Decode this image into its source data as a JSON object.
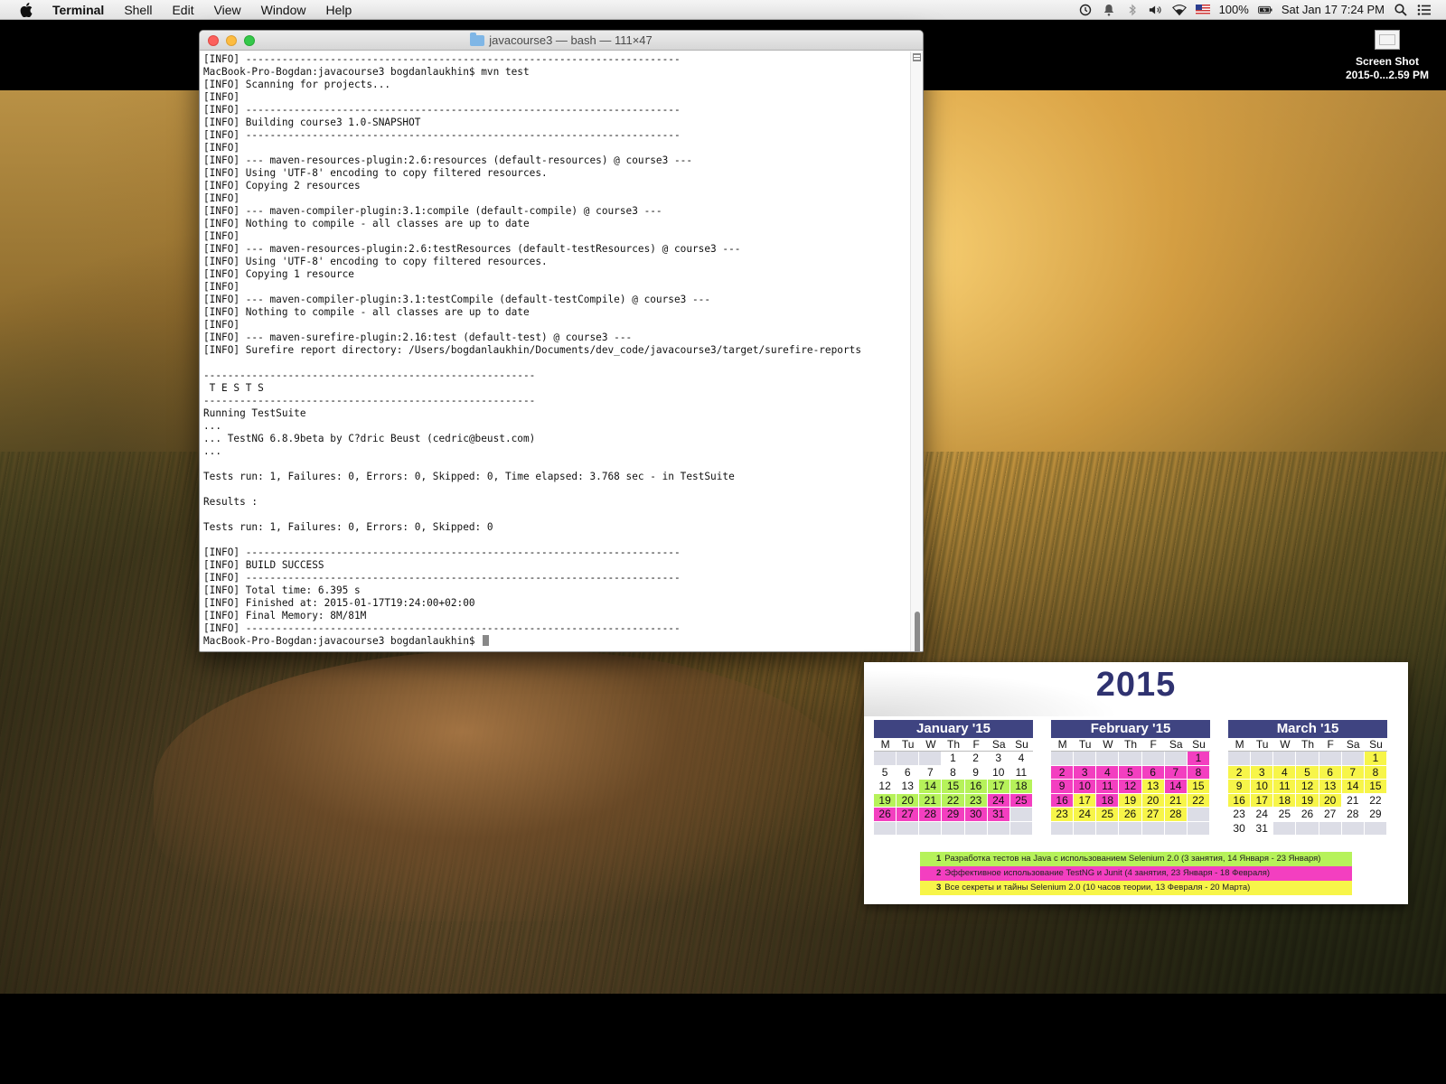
{
  "menubar": {
    "app_name": "Terminal",
    "items": [
      "Shell",
      "Edit",
      "View",
      "Window",
      "Help"
    ],
    "battery": "100%",
    "clock": "Sat Jan 17  7:24 PM"
  },
  "desktop_file": {
    "line1": "Screen Shot",
    "line2": "2015-0...2.59 PM"
  },
  "terminal": {
    "title": "javacourse3 — bash — 111×47",
    "lines": [
      "[INFO] ------------------------------------------------------------------------",
      "MacBook-Pro-Bogdan:javacourse3 bogdanlaukhin$ mvn test",
      "[INFO] Scanning for projects...",
      "[INFO]",
      "[INFO] ------------------------------------------------------------------------",
      "[INFO] Building course3 1.0-SNAPSHOT",
      "[INFO] ------------------------------------------------------------------------",
      "[INFO]",
      "[INFO] --- maven-resources-plugin:2.6:resources (default-resources) @ course3 ---",
      "[INFO] Using 'UTF-8' encoding to copy filtered resources.",
      "[INFO] Copying 2 resources",
      "[INFO]",
      "[INFO] --- maven-compiler-plugin:3.1:compile (default-compile) @ course3 ---",
      "[INFO] Nothing to compile - all classes are up to date",
      "[INFO]",
      "[INFO] --- maven-resources-plugin:2.6:testResources (default-testResources) @ course3 ---",
      "[INFO] Using 'UTF-8' encoding to copy filtered resources.",
      "[INFO] Copying 1 resource",
      "[INFO]",
      "[INFO] --- maven-compiler-plugin:3.1:testCompile (default-testCompile) @ course3 ---",
      "[INFO] Nothing to compile - all classes are up to date",
      "[INFO]",
      "[INFO] --- maven-surefire-plugin:2.16:test (default-test) @ course3 ---",
      "[INFO] Surefire report directory: /Users/bogdanlaukhin/Documents/dev_code/javacourse3/target/surefire-reports",
      "",
      "-------------------------------------------------------",
      " T E S T S",
      "-------------------------------------------------------",
      "Running TestSuite",
      "...",
      "... TestNG 6.8.9beta by C?dric Beust (cedric@beust.com)",
      "...",
      "",
      "Tests run: 1, Failures: 0, Errors: 0, Skipped: 0, Time elapsed: 3.768 sec - in TestSuite",
      "",
      "Results :",
      "",
      "Tests run: 1, Failures: 0, Errors: 0, Skipped: 0",
      "",
      "[INFO] ------------------------------------------------------------------------",
      "[INFO] BUILD SUCCESS",
      "[INFO] ------------------------------------------------------------------------",
      "[INFO] Total time: 6.395 s",
      "[INFO] Finished at: 2015-01-17T19:24:00+02:00",
      "[INFO] Final Memory: 8M/81M",
      "[INFO] ------------------------------------------------------------------------"
    ],
    "prompt": "MacBook-Pro-Bogdan:javacourse3 bogdanlaukhin$ "
  },
  "calendar": {
    "year": "2015",
    "weekdays": [
      "M",
      "Tu",
      "W",
      "Th",
      "F",
      "Sa",
      "Su"
    ],
    "colors": {
      "green": "#b6f25a",
      "pink": "#f33fc0",
      "yellow": "#f7f549"
    },
    "months": [
      {
        "title": "January '15",
        "weeks": [
          [
            [
              "",
              "empty"
            ],
            [
              "",
              "empty"
            ],
            [
              "",
              "empty"
            ],
            [
              "1",
              ""
            ],
            [
              "2",
              ""
            ],
            [
              "3",
              ""
            ],
            [
              "4",
              ""
            ]
          ],
          [
            [
              "5",
              ""
            ],
            [
              "6",
              ""
            ],
            [
              "7",
              ""
            ],
            [
              "8",
              ""
            ],
            [
              "9",
              ""
            ],
            [
              "10",
              ""
            ],
            [
              "11",
              ""
            ]
          ],
          [
            [
              "12",
              ""
            ],
            [
              "13",
              ""
            ],
            [
              "14",
              "green"
            ],
            [
              "15",
              "green"
            ],
            [
              "16",
              "green"
            ],
            [
              "17",
              "green"
            ],
            [
              "18",
              "green"
            ]
          ],
          [
            [
              "19",
              "green"
            ],
            [
              "20",
              "green"
            ],
            [
              "21",
              "green"
            ],
            [
              "22",
              "green"
            ],
            [
              "23",
              "green"
            ],
            [
              "24",
              "pink"
            ],
            [
              "25",
              "pink"
            ]
          ],
          [
            [
              "26",
              "pink"
            ],
            [
              "27",
              "pink"
            ],
            [
              "28",
              "pink"
            ],
            [
              "29",
              "pink"
            ],
            [
              "30",
              "pink"
            ],
            [
              "31",
              "pink"
            ],
            [
              "",
              "empty"
            ]
          ],
          [
            [
              "",
              "empty"
            ],
            [
              "",
              "empty"
            ],
            [
              "",
              "empty"
            ],
            [
              "",
              "empty"
            ],
            [
              "",
              "empty"
            ],
            [
              "",
              "empty"
            ],
            [
              "",
              "empty"
            ]
          ]
        ]
      },
      {
        "title": "February '15",
        "weeks": [
          [
            [
              "",
              "empty"
            ],
            [
              "",
              "empty"
            ],
            [
              "",
              "empty"
            ],
            [
              "",
              "empty"
            ],
            [
              "",
              "empty"
            ],
            [
              "",
              "empty"
            ],
            [
              "1",
              "pink"
            ]
          ],
          [
            [
              "2",
              "pink"
            ],
            [
              "3",
              "pink"
            ],
            [
              "4",
              "pink"
            ],
            [
              "5",
              "pink"
            ],
            [
              "6",
              "pink"
            ],
            [
              "7",
              "pink"
            ],
            [
              "8",
              "pink"
            ]
          ],
          [
            [
              "9",
              "pink"
            ],
            [
              "10",
              "pink"
            ],
            [
              "11",
              "pink"
            ],
            [
              "12",
              "pink"
            ],
            [
              "13",
              "yellow"
            ],
            [
              "14",
              "pink"
            ],
            [
              "15",
              "yellow"
            ]
          ],
          [
            [
              "16",
              "pink"
            ],
            [
              "17",
              "yellow"
            ],
            [
              "18",
              "pink"
            ],
            [
              "19",
              "yellow"
            ],
            [
              "20",
              "yellow"
            ],
            [
              "21",
              "yellow"
            ],
            [
              "22",
              "yellow"
            ]
          ],
          [
            [
              "23",
              "yellow"
            ],
            [
              "24",
              "yellow"
            ],
            [
              "25",
              "yellow"
            ],
            [
              "26",
              "yellow"
            ],
            [
              "27",
              "yellow"
            ],
            [
              "28",
              "yellow"
            ],
            [
              "",
              "empty"
            ]
          ],
          [
            [
              "",
              "empty"
            ],
            [
              "",
              "empty"
            ],
            [
              "",
              "empty"
            ],
            [
              "",
              "empty"
            ],
            [
              "",
              "empty"
            ],
            [
              "",
              "empty"
            ],
            [
              "",
              "empty"
            ]
          ]
        ]
      },
      {
        "title": "March '15",
        "weeks": [
          [
            [
              "",
              "empty"
            ],
            [
              "",
              "empty"
            ],
            [
              "",
              "empty"
            ],
            [
              "",
              "empty"
            ],
            [
              "",
              "empty"
            ],
            [
              "",
              "empty"
            ],
            [
              "1",
              "yellow"
            ]
          ],
          [
            [
              "2",
              "yellow"
            ],
            [
              "3",
              "yellow"
            ],
            [
              "4",
              "yellow"
            ],
            [
              "5",
              "yellow"
            ],
            [
              "6",
              "yellow"
            ],
            [
              "7",
              "yellow"
            ],
            [
              "8",
              "yellow"
            ]
          ],
          [
            [
              "9",
              "yellow"
            ],
            [
              "10",
              "yellow"
            ],
            [
              "11",
              "yellow"
            ],
            [
              "12",
              "yellow"
            ],
            [
              "13",
              "yellow"
            ],
            [
              "14",
              "yellow"
            ],
            [
              "15",
              "yellow"
            ]
          ],
          [
            [
              "16",
              "yellow"
            ],
            [
              "17",
              "yellow"
            ],
            [
              "18",
              "yellow"
            ],
            [
              "19",
              "yellow"
            ],
            [
              "20",
              "yellow"
            ],
            [
              "21",
              ""
            ],
            [
              "22",
              ""
            ]
          ],
          [
            [
              "23",
              ""
            ],
            [
              "24",
              ""
            ],
            [
              "25",
              ""
            ],
            [
              "26",
              ""
            ],
            [
              "27",
              ""
            ],
            [
              "28",
              ""
            ],
            [
              "29",
              ""
            ]
          ],
          [
            [
              "30",
              ""
            ],
            [
              "31",
              ""
            ],
            [
              "",
              "empty"
            ],
            [
              "",
              "empty"
            ],
            [
              "",
              "empty"
            ],
            [
              "",
              "empty"
            ],
            [
              "",
              "empty"
            ]
          ]
        ]
      }
    ],
    "legend": [
      {
        "num": "1",
        "text": "Разработка тестов на Java с использованием Selenium 2.0 (3 занятия, 14 Января - 23 Января)",
        "color": "green"
      },
      {
        "num": "2",
        "text": "Эффективное использование TestNG и Junit (4 занятия, 23 Января - 18 Февраля)",
        "color": "pink"
      },
      {
        "num": "3",
        "text": "Все секреты и тайны Selenium 2.0 (10 часов теории, 13 Февраля - 20 Марта)",
        "color": "yellow"
      }
    ]
  }
}
